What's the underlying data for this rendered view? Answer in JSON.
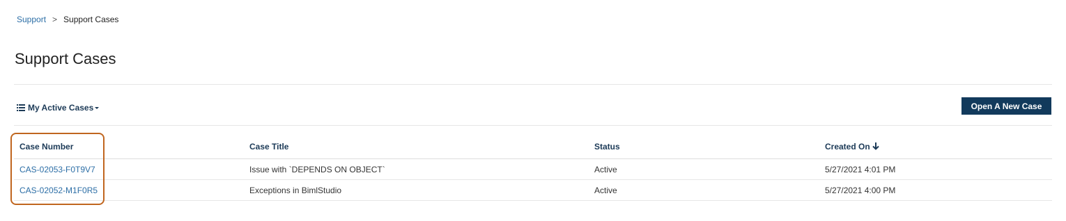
{
  "breadcrumb": {
    "parent": "Support",
    "separator": ">",
    "current": "Support Cases"
  },
  "page_title": "Support Cases",
  "toolbar": {
    "view_label": "My Active Cases",
    "view_icon": "list-icon",
    "new_case_label": "Open A New Case"
  },
  "table": {
    "columns": [
      "Case Number",
      "Case Title",
      "Status",
      "Created On"
    ],
    "sort_icon": "arrow-down-icon",
    "rows": [
      {
        "case_number": "CAS-02053-F0T9V7",
        "case_title": "Issue with `DEPENDS ON OBJECT`",
        "status": "Active",
        "created_on": "5/27/2021 4:01 PM"
      },
      {
        "case_number": "CAS-02052-M1F0R5",
        "case_title": "Exceptions in BimlStudio",
        "status": "Active",
        "created_on": "5/27/2021 4:00 PM"
      }
    ]
  },
  "colors": {
    "link": "#2c6ea6",
    "header_text": "#1c3a57",
    "button_bg": "#123a5c",
    "highlight_border": "#c0661f"
  }
}
